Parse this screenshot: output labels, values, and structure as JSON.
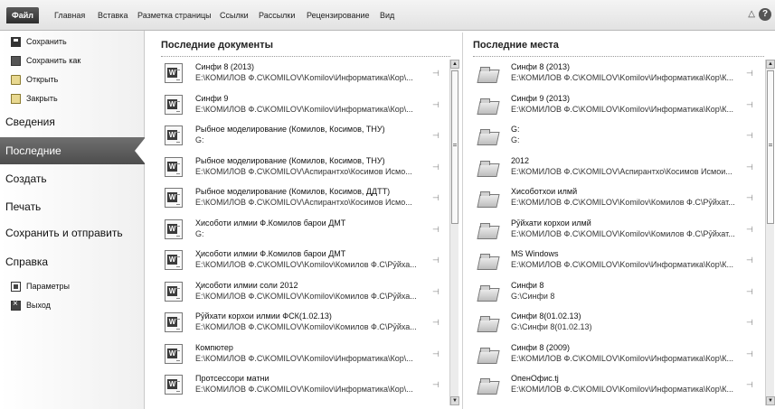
{
  "ribbon": {
    "file_tab": "Файл",
    "tabs": [
      "Главная",
      "Вставка",
      "Разметка страницы",
      "Ссылки",
      "Рассылки",
      "Рецензирование",
      "Вид"
    ],
    "help_icon": "?"
  },
  "left_menu": {
    "save": "Сохранить",
    "save_as": "Сохранить как",
    "open": "Открыть",
    "close": "Закрыть",
    "info": "Сведения",
    "recent": "Последние",
    "new": "Создать",
    "print": "Печать",
    "save_send": "Сохранить и отправить",
    "help": "Справка",
    "options": "Параметры",
    "exit": "Выход"
  },
  "recent_docs": {
    "title": "Последние документы",
    "items": [
      {
        "title": "Синфи 8 (2013)",
        "path": "E:\\КОМИЛОВ Ф.С\\KOMILOV\\Komilov\\Информатика\\Кор\\..."
      },
      {
        "title": "Синфи 9",
        "path": "E:\\КОМИЛОВ Ф.С\\KOMILOV\\Komilov\\Информатика\\Кор\\..."
      },
      {
        "title": "Рыбное моделирование (Комилов, Косимов, ТНУ)",
        "path": "G:"
      },
      {
        "title": "Рыбное моделирование (Комилов, Косимов, ТНУ)",
        "path": "E:\\КОМИЛОВ Ф.С\\KOMILOV\\Аспирантхо\\Косимов Исмо..."
      },
      {
        "title": "Рыбное моделирование (Комилов, Косимов, ДДТТ)",
        "path": "E:\\КОМИЛОВ Ф.С\\KOMILOV\\Аспирантхо\\Косимов Исмо..."
      },
      {
        "title": "Хисоботи илмии Ф.Комилов барои ДМТ",
        "path": "G:"
      },
      {
        "title": "Ҳисоботи илмии Ф.Комилов барои ДМТ",
        "path": "E:\\КОМИЛОВ Ф.С\\KOMILOV\\Komilov\\Комилов Ф.С\\Рӯйха..."
      },
      {
        "title": "Ҳисоботи илмии соли 2012",
        "path": "E:\\КОМИЛОВ Ф.С\\KOMILOV\\Komilov\\Комилов Ф.С\\Рӯйха..."
      },
      {
        "title": "Рӯйхати корхои илмии ФСК(1.02.13)",
        "path": "E:\\КОМИЛОВ Ф.С\\KOMILOV\\Komilov\\Комилов Ф.С\\Рӯйха..."
      },
      {
        "title": "Компютер",
        "path": "E:\\КОМИЛОВ Ф.С\\KOMILOV\\Komilov\\Информатика\\Кор\\..."
      },
      {
        "title": "Протсессори матни",
        "path": "E:\\КОМИЛОВ Ф.С\\KOMILOV\\Komilov\\Информатика\\Кор\\..."
      }
    ]
  },
  "recent_places": {
    "title": "Последние места",
    "items": [
      {
        "title": "Синфи 8 (2013)",
        "path": "E:\\КОМИЛОВ Ф.С\\KOMILOV\\Komilov\\Информатика\\Кор\\К..."
      },
      {
        "title": "Синфи 9 (2013)",
        "path": "E:\\КОМИЛОВ Ф.С\\KOMILOV\\Komilov\\Информатика\\Кор\\К..."
      },
      {
        "title": "G:",
        "path": "G:"
      },
      {
        "title": "2012",
        "path": "E:\\КОМИЛОВ Ф.С\\KOMILOV\\Аспирантхо\\Косимов Исмои..."
      },
      {
        "title": "Хисоботхои илмй",
        "path": "E:\\КОМИЛОВ Ф.С\\KOMILOV\\Komilov\\Комилов Ф.С\\Рӯйхат..."
      },
      {
        "title": "Рӯйхати корхои илмй",
        "path": "E:\\КОМИЛОВ Ф.С\\KOMILOV\\Komilov\\Комилов Ф.С\\Рӯйхат..."
      },
      {
        "title": "MS Windows",
        "path": "E:\\КОМИЛОВ Ф.С\\KOMILOV\\Komilov\\Информатика\\Кор\\К..."
      },
      {
        "title": "Синфи 8",
        "path": "G:\\Синфи 8"
      },
      {
        "title": "Синфи 8(01.02.13)",
        "path": "G:\\Синфи 8(01.02.13)"
      },
      {
        "title": "Синфи 8 (2009)",
        "path": "E:\\КОМИЛОВ Ф.С\\KOMILOV\\Komilov\\Информатика\\Кор\\К..."
      },
      {
        "title": "ОпенОфис.tj",
        "path": "E:\\КОМИЛОВ Ф.С\\KOMILOV\\Komilov\\Информатика\\Кор\\К..."
      }
    ]
  },
  "icons": {
    "pin": "pin-icon",
    "word_doc": "word-document-icon",
    "folder": "folder-icon"
  },
  "colors": {
    "active_menu": "#5e5e5e",
    "file_tab": "#3a3a3a"
  }
}
